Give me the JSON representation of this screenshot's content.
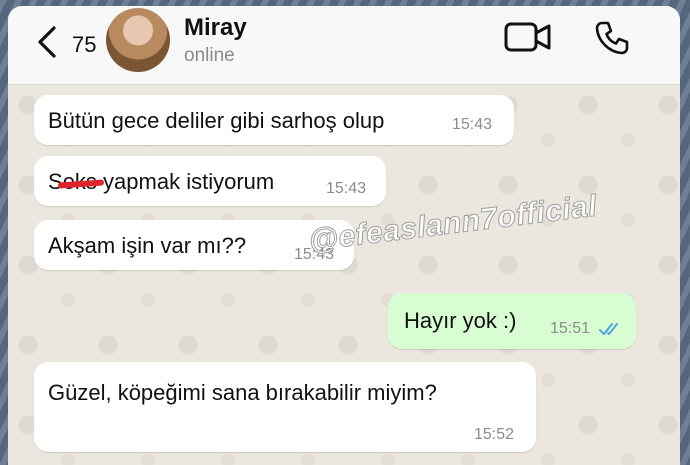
{
  "header": {
    "back_count": "75",
    "contact_name": "Miray",
    "contact_status": "online"
  },
  "messages": [
    {
      "direction": "in",
      "text": "Bütün gece deliler gibi sarhoş olup",
      "time": "15:43"
    },
    {
      "direction": "in",
      "text_prefix": "S",
      "text_redacted": "eks",
      "text_suffix": " yapmak istiyorum",
      "time": "15:43"
    },
    {
      "direction": "in",
      "text": "Akşam işin var mı??",
      "time": "15:43"
    },
    {
      "direction": "out",
      "text": "Hayır yok :)",
      "time": "15:51",
      "status": "read"
    },
    {
      "direction": "in",
      "text": "Güzel, köpeğimi sana bırakabilir miyim?",
      "time": "15:52"
    }
  ],
  "watermark": "@efeaslann7official",
  "colors": {
    "outgoing_bubble": "#d9fdd3",
    "incoming_bubble": "#ffffff",
    "read_ticks": "#4fa3e0",
    "redaction": "#e0242c"
  },
  "icons": [
    "chevron-left-icon",
    "video-camera-icon",
    "phone-icon",
    "double-check-icon"
  ]
}
